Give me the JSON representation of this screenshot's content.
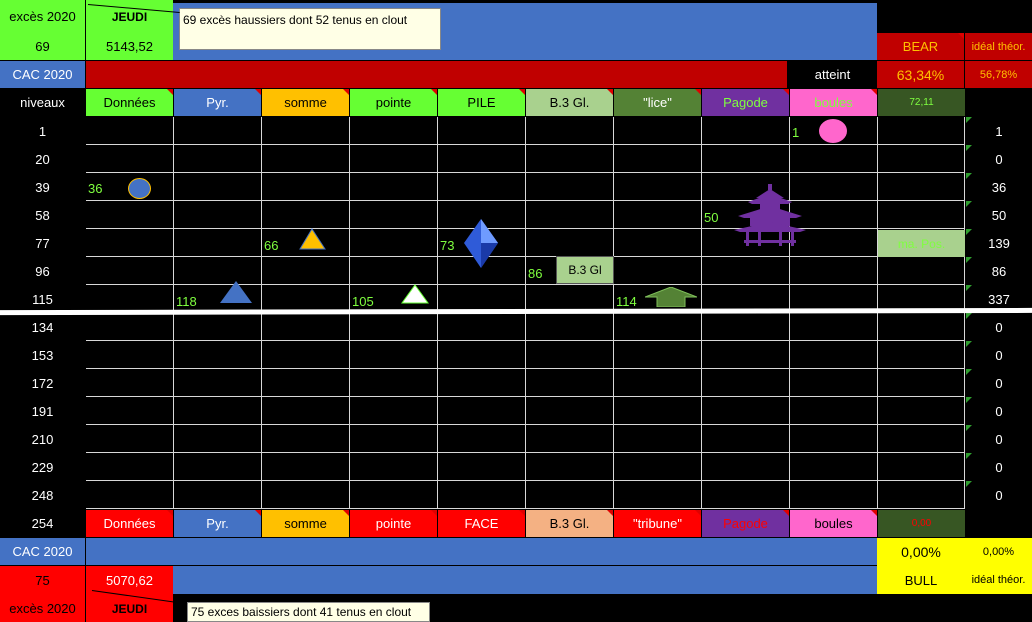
{
  "top": {
    "exces_label": "excès 2020",
    "exces_value": "69",
    "day": "JEUDI",
    "price": "5143,52",
    "comment": "69 excès haussiers dont 52 tenus en clout",
    "index_label": "CAC 2020",
    "bear_label": "BEAR",
    "ideal_label": "idéal théor.",
    "atteint_label": "atteint",
    "atteint_value": "63,34%",
    "ideal_value": "56,78%"
  },
  "header": {
    "niveaux": "niveaux",
    "cols": [
      "Données",
      "Pyr.",
      "somme",
      "pointe",
      "PILE",
      "B.3 Gl.",
      "\"lice\"",
      "Pagode",
      "boules"
    ],
    "extra": "72,11"
  },
  "levels": [
    "1",
    "20",
    "39",
    "58",
    "77",
    "96",
    "115",
    "134",
    "153",
    "172",
    "191",
    "210",
    "229",
    "248"
  ],
  "right_values": [
    "1",
    "0",
    "36",
    "50",
    "139",
    "86",
    "337",
    "0",
    "0",
    "0",
    "0",
    "0",
    "0",
    "0"
  ],
  "markers": {
    "donnees": "36",
    "pyr": "118",
    "somme": "66",
    "pointe": "105",
    "pile": "73",
    "b3": "86",
    "b3_box": "B.3 Gl",
    "lice": "114",
    "pagode": "50",
    "boules": "1",
    "moy_label": "ma. Pos."
  },
  "footer": {
    "level": "254",
    "cols": [
      "Données",
      "Pyr.",
      "somme",
      "pointe",
      "FACE",
      "B.3 Gl.",
      "\"tribune\"",
      "Pagode",
      "boules"
    ],
    "extra": "0,00"
  },
  "bottom": {
    "index_label": "CAC 2020",
    "pct_value": "0,00%",
    "pct_small": "0,00%",
    "bull_label": "BULL",
    "ideal_label": "idéal théor.",
    "exces_value": "75",
    "price": "5070,62",
    "exces_label": "excès 2020",
    "day": "JEUDI",
    "comment": "75 exces baissiers dont 41 tenus en clout"
  },
  "colors": {
    "green": "#66ff33",
    "blue": "#4472c4",
    "red": "#c00000",
    "purple": "#7030a0",
    "pink": "#ff66cc",
    "orange": "#ffc000",
    "salmon": "#f4b183",
    "yellow": "#ffff00"
  }
}
